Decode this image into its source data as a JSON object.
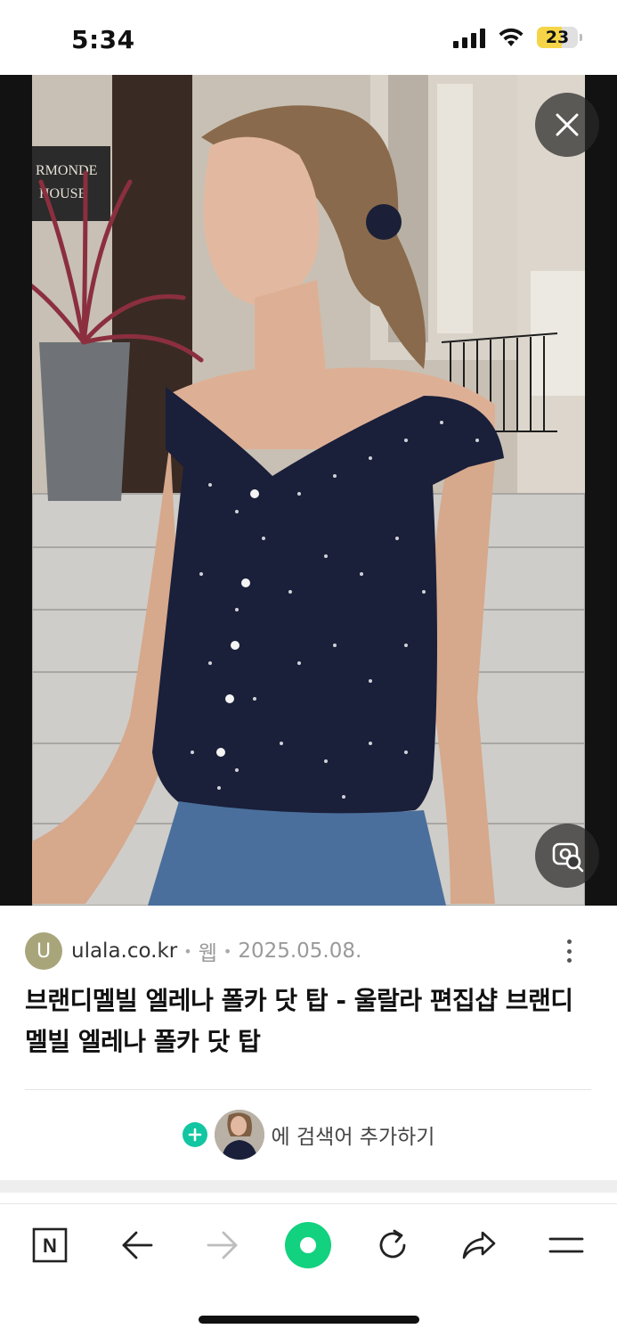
{
  "status_bar": {
    "time": "5:34",
    "battery_level": "23",
    "battery_color": "#f5d547",
    "signal_icon": "cellular-signal-icon",
    "wifi_icon": "wifi-icon"
  },
  "viewer": {
    "close_icon": "close-icon",
    "lens_icon": "image-search-icon",
    "photo_sign_text": "RMONDE HOUSE"
  },
  "result": {
    "favicon_letter": "U",
    "favicon_color": "#a8a57b",
    "domain": "ulala.co.kr",
    "type": "웹",
    "date": "2025.05.08.",
    "title": "브랜디멜빌 엘레나 폴카 닷 탑 - 울랄라 편집샵 브랜디멜빌 엘레나 폴카 닷 탑",
    "add_search_label": "에 검색어 추가하기",
    "accent_color": "#12c6a1"
  },
  "toolbar": {
    "items": [
      {
        "name": "naver-home-icon"
      },
      {
        "name": "back-arrow-icon"
      },
      {
        "name": "forward-arrow-icon"
      },
      {
        "name": "green-dot-icon"
      },
      {
        "name": "refresh-icon"
      },
      {
        "name": "share-icon"
      },
      {
        "name": "menu-icon"
      }
    ],
    "home_label": "N"
  }
}
